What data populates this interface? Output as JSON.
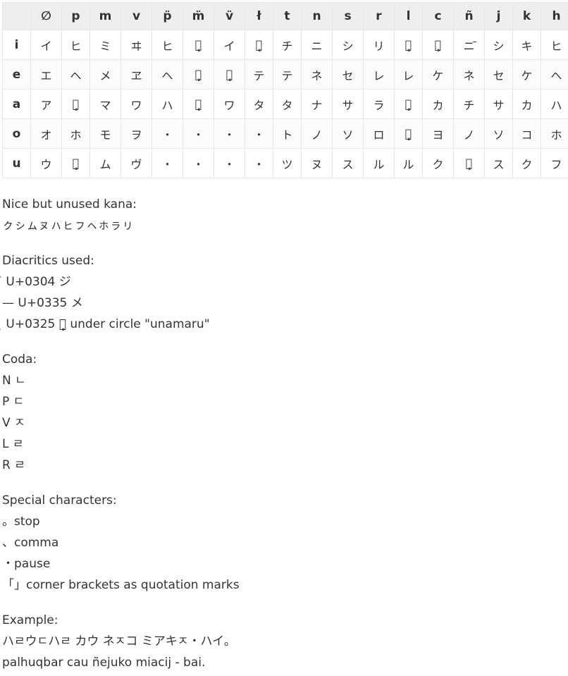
{
  "table": {
    "corner": "",
    "columns": [
      "∅",
      "p",
      "m",
      "v",
      "p̈",
      "m̈",
      "v̈",
      "ł",
      "t",
      "n",
      "s",
      "r",
      "l",
      "c",
      "ñ",
      "j",
      "k",
      "h"
    ],
    "rows": [
      {
        "label": "i",
        "cells": [
          "イ",
          "ヒ",
          "ミ",
          "ヰ",
          "ヒ",
          "ミ̥",
          "イ",
          "チ̥",
          "チ",
          "ニ",
          "シ",
          "リ",
          "リ̥",
          "キ̥",
          "ニ̄",
          "シ",
          "キ",
          "ヒ"
        ]
      },
      {
        "label": "e",
        "cells": [
          "エ",
          "ヘ",
          "メ",
          "ヱ",
          "ヘ",
          "メ̥",
          "エ̥",
          "テ",
          "テ",
          "ネ",
          "セ",
          "レ",
          "レ",
          "ケ",
          "ネ",
          "セ",
          "ケ",
          "ヘ"
        ]
      },
      {
        "label": "a",
        "cells": [
          "ア",
          "ハ̥",
          "マ",
          "ワ",
          "ハ",
          "マ̥",
          "ワ",
          "タ",
          "タ",
          "ナ",
          "サ",
          "ラ",
          "ラ̥",
          "カ",
          "チ",
          "サ",
          "カ",
          "ハ"
        ]
      },
      {
        "label": "o",
        "cells": [
          "オ",
          "ホ",
          "モ",
          "ヲ",
          "・",
          "・",
          "・",
          "・",
          "ト",
          "ノ",
          "ソ",
          "ロ",
          "ロ̥",
          "ヨ",
          "ノ",
          "ソ",
          "コ",
          "ホ"
        ]
      },
      {
        "label": "u",
        "cells": [
          "ウ",
          "フ̥",
          "ム",
          "ヴ",
          "・",
          "・",
          "・",
          "・",
          "ツ",
          "ヌ",
          "ス",
          "ル",
          "ル",
          "ク",
          "ヌ̥",
          "ス",
          "ク",
          "フ"
        ]
      }
    ]
  },
  "sections": [
    {
      "lines": [
        "Nice but unused kana:",
        "ㇰㇱㇺㇴㇵㇶㇷㇸㇹㇻㇼ"
      ]
    },
    {
      "lines": [
        "Diacritics used:",
        "̄ U+0304 ジ",
        "— U+0335 メ",
        "̥ U+0325 シ̥ under circle \"unamaru\""
      ]
    },
    {
      "lines": [
        "Coda:",
        "N ㄴ",
        "P ㄷ",
        "V ㅈ",
        "L ㄹ",
        "R ㄹ"
      ]
    },
    {
      "lines": [
        "Special characters:",
        "。stop",
        "、comma",
        "・pause",
        "「」corner brackets as quotation marks"
      ]
    },
    {
      "lines": [
        "Example:",
        "ハㄹウㄷハㄹ カウ ネㅈコ ミアキㅈ・ハイ。",
        "palhuqbar cau ñejuko miacij - bai."
      ]
    }
  ]
}
